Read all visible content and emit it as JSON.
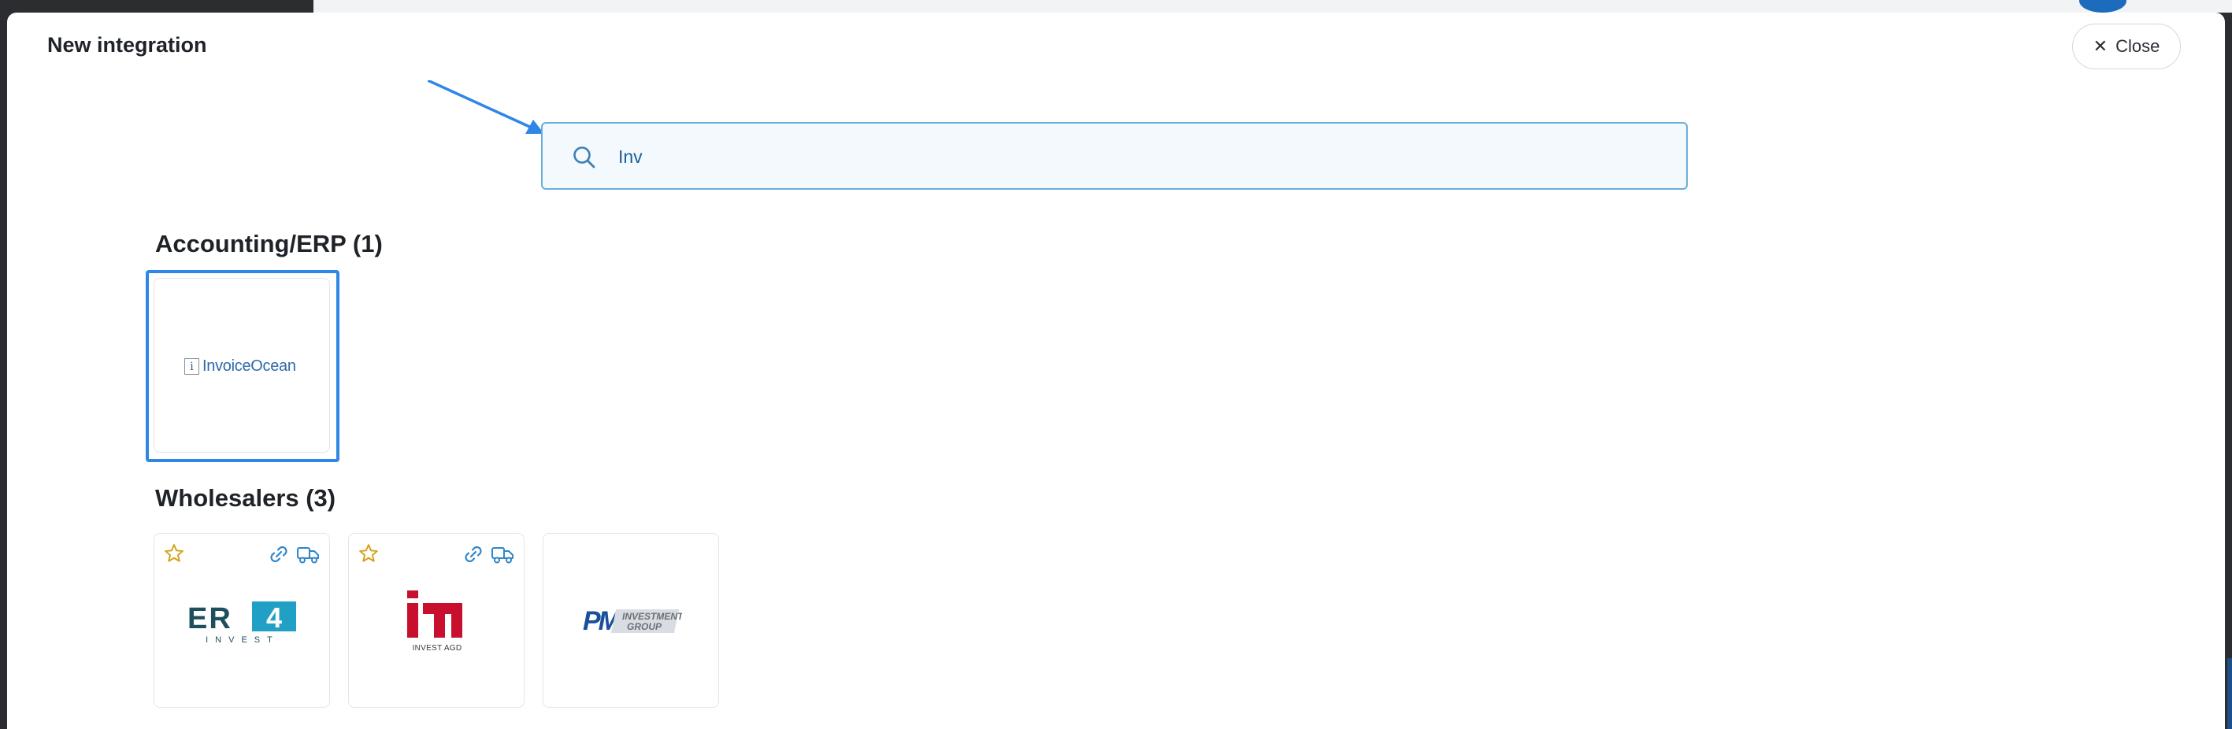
{
  "modal": {
    "title": "New integration",
    "close_label": "Close"
  },
  "search": {
    "value": "Inv"
  },
  "sections": [
    {
      "title": "Accounting/ERP (1)",
      "cards": [
        {
          "name": "InvoiceOcean",
          "logo_mark": "i",
          "selected": true
        }
      ]
    },
    {
      "title": "Wholesalers (3)",
      "cards": [
        {
          "name": "ER4 INVEST",
          "logo_text": "ER",
          "logo_number": "4",
          "logo_sub": "INVEST",
          "icons": [
            "star-icon",
            "link-icon",
            "truck-icon"
          ]
        },
        {
          "name": "INVEST AGD",
          "logo_sub": "INVEST AGD",
          "icons": [
            "star-icon",
            "link-icon",
            "truck-icon"
          ]
        },
        {
          "name": "PM Investment Group",
          "logo_text": "PM",
          "logo_sub1": "INVESTMENT",
          "logo_sub2": "GROUP"
        }
      ]
    }
  ],
  "colors": {
    "accent": "#2f86e6",
    "link_icon": "#2f86c8",
    "star": "#d4a21a",
    "er4_dark": "#1f4f5c",
    "er4_teal": "#1fa0c4",
    "invest_agd_red": "#c8102e",
    "pm_blue": "#1a4f9c"
  }
}
